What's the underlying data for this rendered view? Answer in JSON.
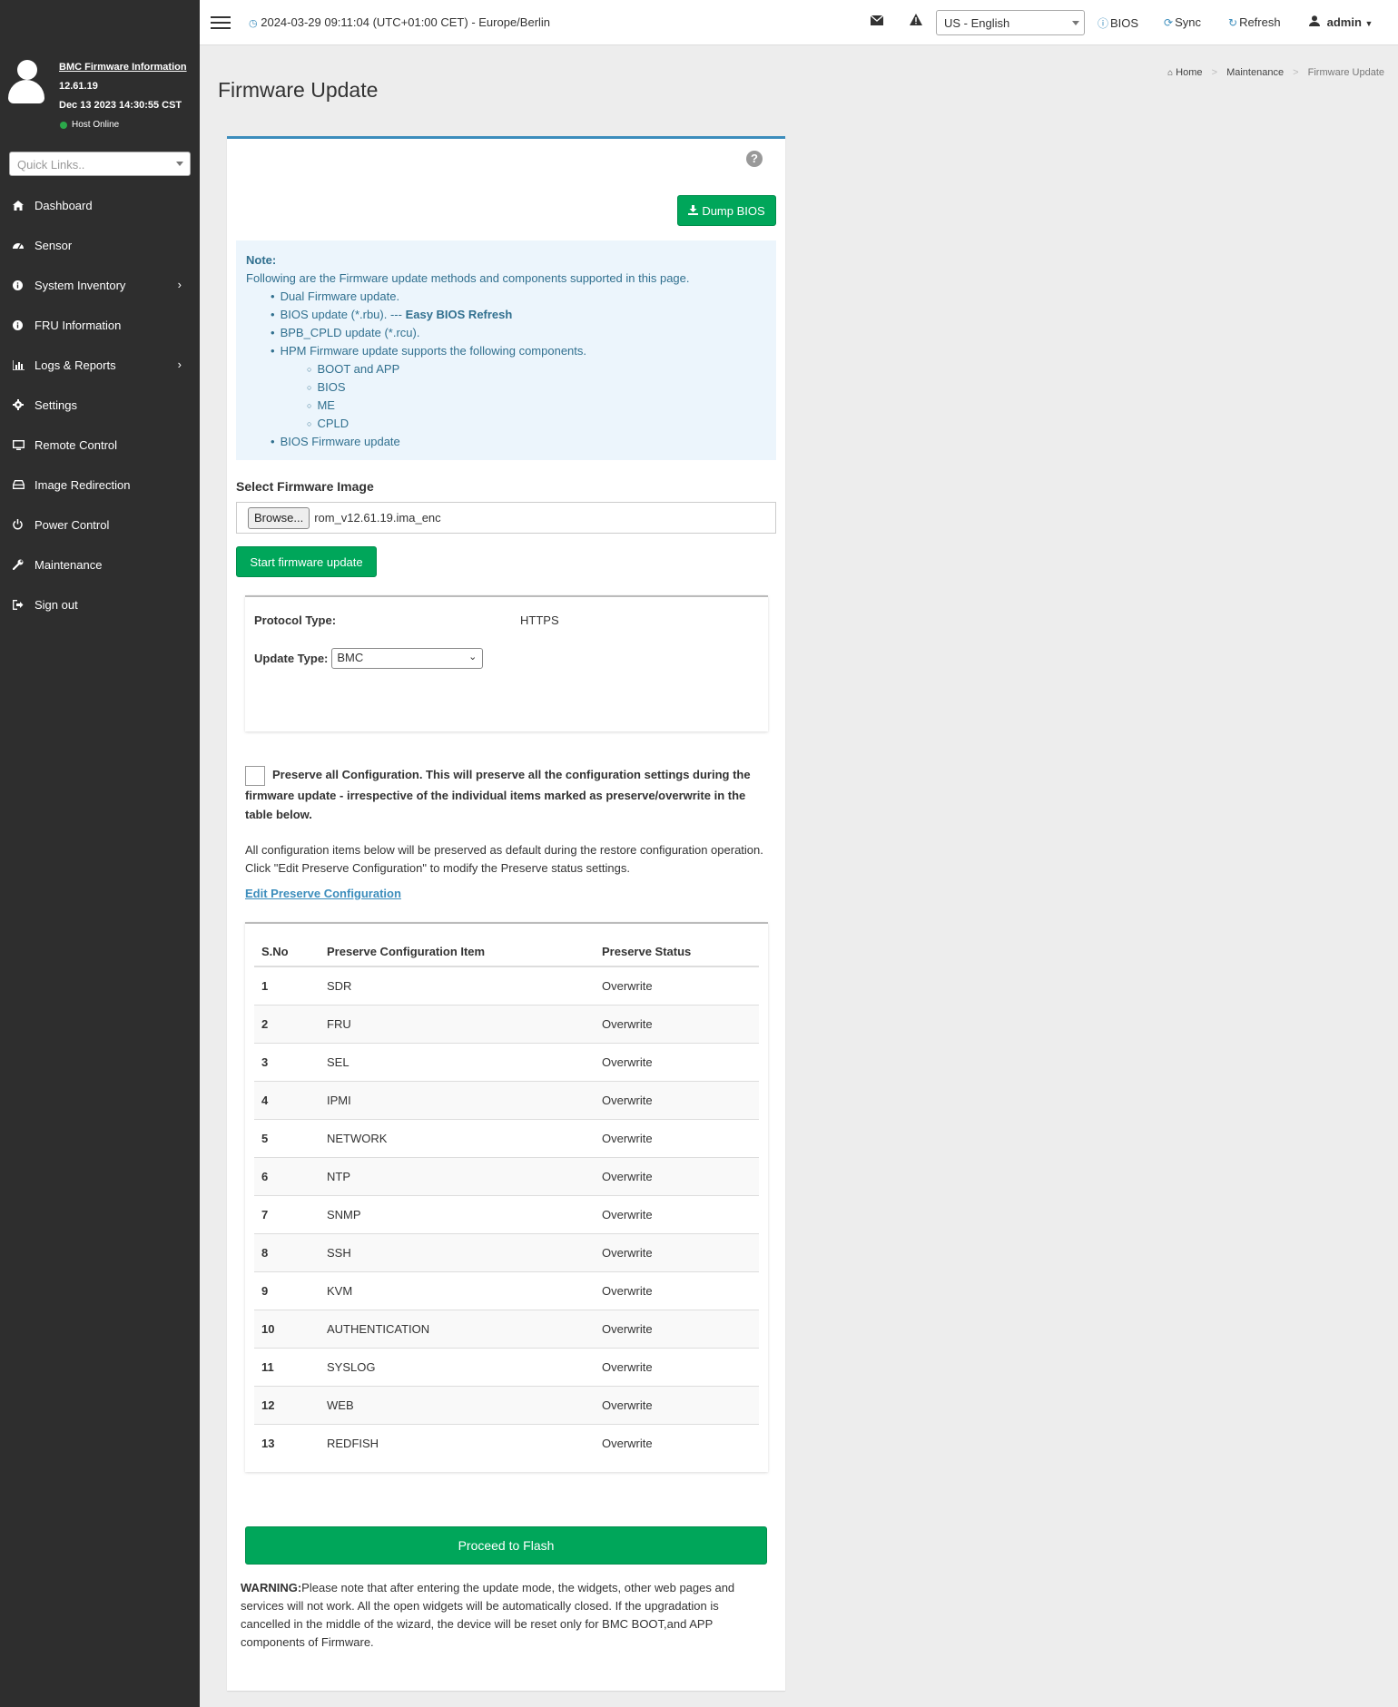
{
  "header": {
    "datetime": "2024-03-29 09:11:04 (UTC+01:00 CET) - Europe/Berlin",
    "language": "US - English",
    "bios_label": "BIOS",
    "sync_label": "Sync",
    "refresh_label": "Refresh",
    "user_label": "admin"
  },
  "sidebar": {
    "fw_info_title": "BMC Firmware Information",
    "fw_version": "12.61.19",
    "fw_date": "Dec 13 2023 14:30:55 CST",
    "host_status": "Host Online",
    "quick_links_placeholder": "Quick Links..",
    "items": [
      {
        "label": "Dashboard",
        "icon": "home-icon"
      },
      {
        "label": "Sensor",
        "icon": "dashboard-gauge-icon"
      },
      {
        "label": "System Inventory",
        "icon": "info-icon"
      },
      {
        "label": "FRU Information",
        "icon": "info-icon"
      },
      {
        "label": "Logs & Reports",
        "icon": "bar-chart-icon"
      },
      {
        "label": "Settings",
        "icon": "gear-icon"
      },
      {
        "label": "Remote Control",
        "icon": "monitor-icon"
      },
      {
        "label": "Image Redirection",
        "icon": "drive-icon"
      },
      {
        "label": "Power Control",
        "icon": "power-icon"
      },
      {
        "label": "Maintenance",
        "icon": "wrench-icon"
      },
      {
        "label": "Sign out",
        "icon": "sign-out-icon"
      }
    ]
  },
  "page": {
    "title": "Firmware Update",
    "breadcrumb": [
      "Home",
      "Maintenance",
      "Firmware Update"
    ]
  },
  "content": {
    "dump_bios_label": "Dump BIOS",
    "note_title": "Note:",
    "note_intro": "Following are the Firmware update methods and components supported in this page.",
    "note_items": [
      "Dual Firmware update.",
      "BIOS update (*.rbu). --- ",
      "BPB_CPLD update (*.rcu).",
      "HPM Firmware update supports the following components.",
      "BIOS Firmware update"
    ],
    "note_easy_bios": "Easy BIOS Refresh",
    "hpm_components": [
      "BOOT and APP",
      "BIOS",
      "ME",
      "CPLD"
    ],
    "select_image_label": "Select Firmware Image",
    "browse_label": "Browse...",
    "selected_file": "rom_v12.61.19.ima_enc",
    "start_update_label": "Start firmware update",
    "protocol_label": "Protocol Type:",
    "protocol_value": "HTTPS",
    "update_type_label": "Update Type:",
    "update_type_value": "BMC",
    "preserve_all_text": "Preserve all Configuration. This will preserve all the configuration settings during the firmware update - irrespective of the individual items marked as preserve/overwrite in the table below.",
    "info_text": "All configuration items below will be preserved as default during the restore configuration operation. Click \"Edit Preserve Configuration\" to modify the Preserve status settings.",
    "edit_link": "Edit Preserve Configuration",
    "table_headers": [
      "S.No",
      "Preserve Configuration Item",
      "Preserve Status"
    ],
    "table_rows": [
      [
        "1",
        "SDR",
        "Overwrite"
      ],
      [
        "2",
        "FRU",
        "Overwrite"
      ],
      [
        "3",
        "SEL",
        "Overwrite"
      ],
      [
        "4",
        "IPMI",
        "Overwrite"
      ],
      [
        "5",
        "NETWORK",
        "Overwrite"
      ],
      [
        "6",
        "NTP",
        "Overwrite"
      ],
      [
        "7",
        "SNMP",
        "Overwrite"
      ],
      [
        "8",
        "SSH",
        "Overwrite"
      ],
      [
        "9",
        "KVM",
        "Overwrite"
      ],
      [
        "10",
        "AUTHENTICATION",
        "Overwrite"
      ],
      [
        "11",
        "SYSLOG",
        "Overwrite"
      ],
      [
        "12",
        "WEB",
        "Overwrite"
      ],
      [
        "13",
        "REDFISH",
        "Overwrite"
      ]
    ],
    "proceed_label": "Proceed to Flash",
    "warning_label": "WARNING:",
    "warning_text": "Please note that after entering the update mode, the widgets, other web pages and services will not work. All the open widgets will be automatically closed. If the upgradation is cancelled in the middle of the wizard, the device will be reset only for BMC BOOT,and APP components of Firmware."
  },
  "colors": {
    "sidebar_bg": "#2e2e2e",
    "accent": "#3c8dbc",
    "button_green": "#00a65a",
    "note_bg": "#ecf5fc",
    "note_text": "#31708f"
  }
}
